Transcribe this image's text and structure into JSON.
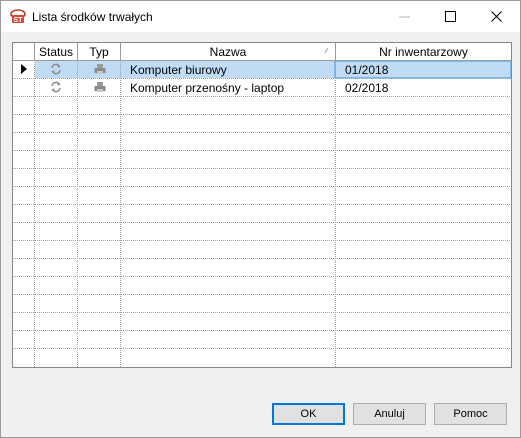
{
  "window": {
    "title": "Lista środków trwałych",
    "icon": "app-logo-icon",
    "controls": [
      "minimize-icon",
      "maximize-icon",
      "close-icon"
    ]
  },
  "grid": {
    "columns": [
      "Status",
      "Typ",
      "Nazwa",
      "Nr inwentarzowy"
    ],
    "rows": [
      {
        "status_icon": "refresh-icon",
        "type_icon": "printer-icon",
        "name": "Komputer biurowy",
        "inventory": "01/2018",
        "selected": true
      },
      {
        "status_icon": "refresh-icon",
        "type_icon": "printer-icon",
        "name": "Komputer przenośny - laptop",
        "inventory": "02/2018",
        "selected": false
      }
    ],
    "selection_color": "#bfdcf4"
  },
  "buttons": {
    "ok": "OK",
    "cancel": "Anuluj",
    "help": "Pomoc"
  }
}
